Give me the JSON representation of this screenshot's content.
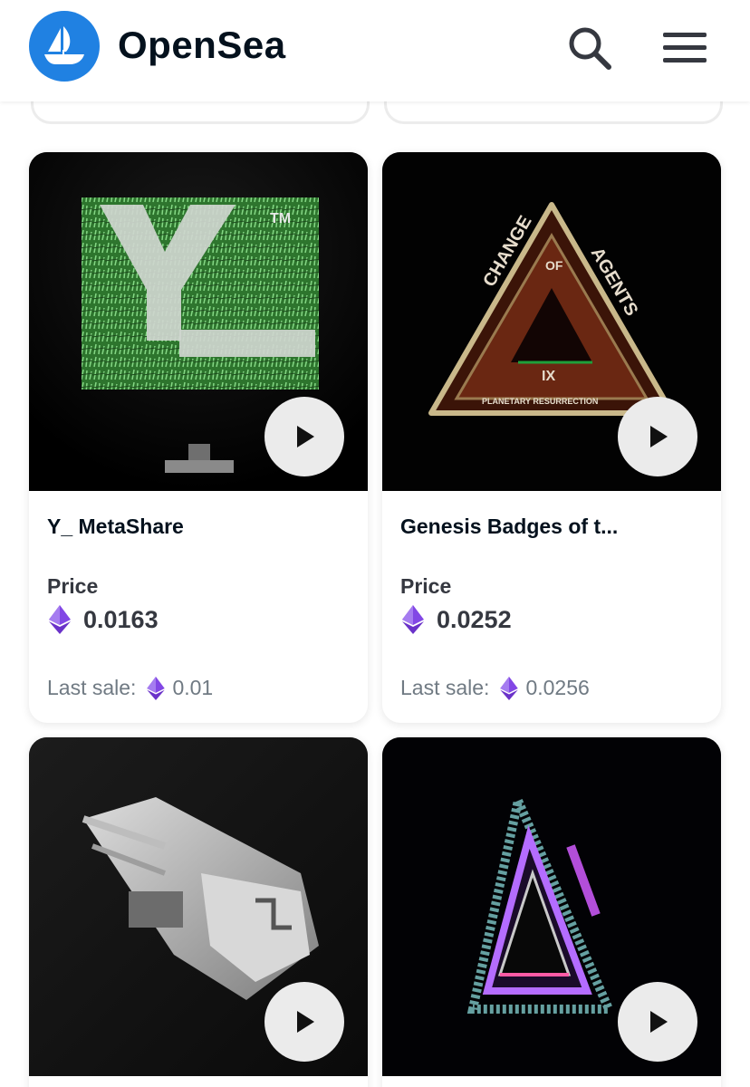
{
  "header": {
    "brand": "OpenSea",
    "logo_icon": "opensea-boat-icon",
    "search_icon": "search-icon",
    "menu_icon": "hamburger-menu-icon",
    "brand_color": "#2081e2"
  },
  "cards": [
    {
      "title": "Y_ MetaShare",
      "price_label": "Price",
      "price": "0.0163",
      "last_sale_label": "Last sale:",
      "last_sale": "0.01",
      "media": "green-grass-y-logo-video",
      "image_text": "TM"
    },
    {
      "title": "Genesis Badges of t...",
      "price_label": "Price",
      "price": "0.0252",
      "last_sale_label": "Last sale:",
      "last_sale": "0.0256",
      "media": "triangle-badge-video",
      "image_text": [
        "AGENTS",
        "OF",
        "CHANGE",
        "IX",
        "PLANETARY RESURRECTION"
      ]
    },
    {
      "media": "silver-spaceship-video"
    },
    {
      "media": "neon-triangle-video"
    }
  ],
  "colors": {
    "eth_purple": "#8247e5",
    "text_dark": "#04111d",
    "text_muted": "#707a83"
  }
}
